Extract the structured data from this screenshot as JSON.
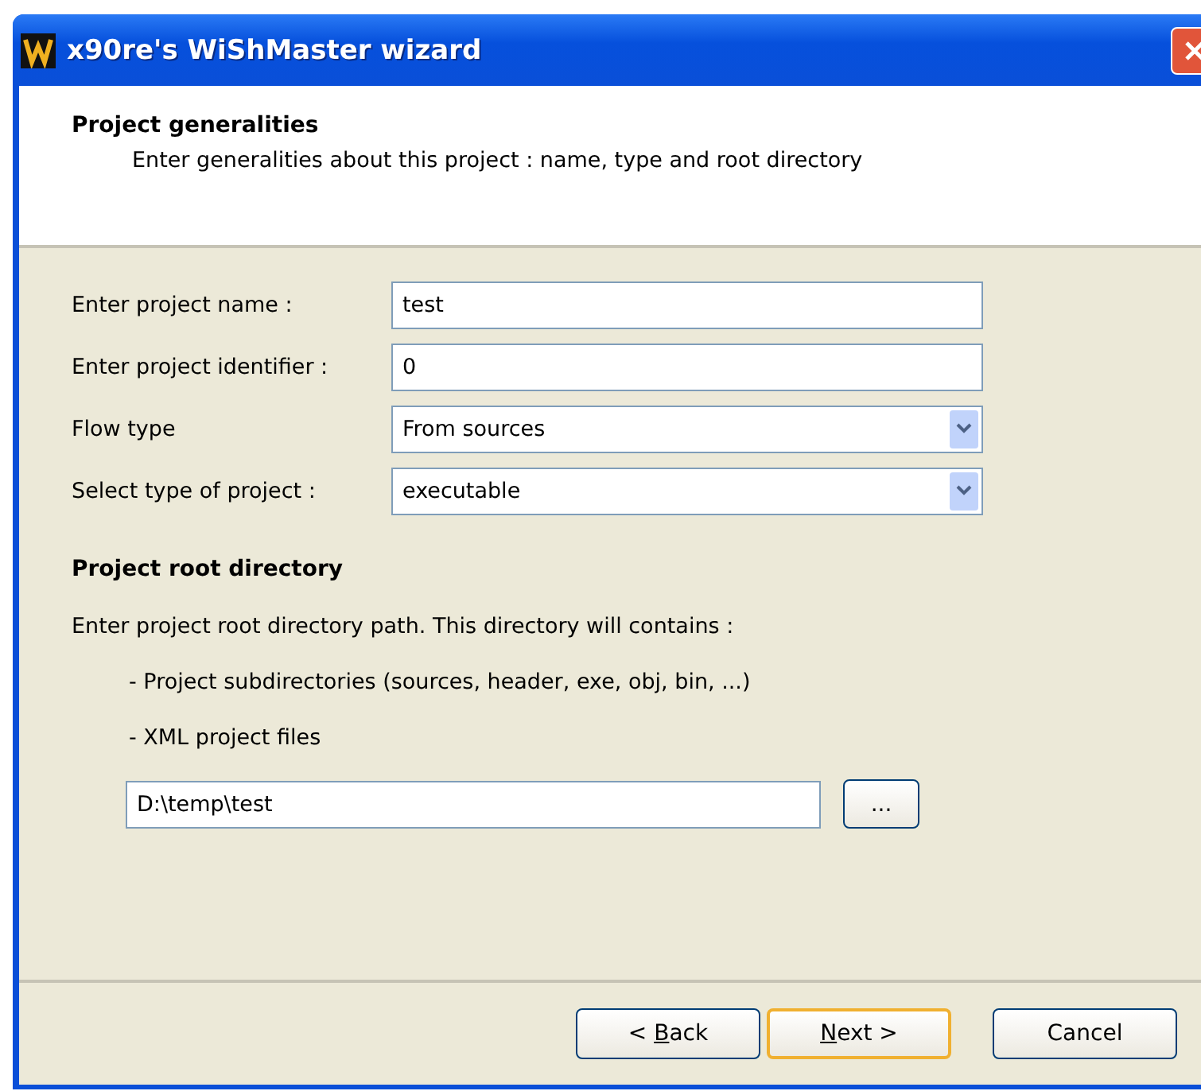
{
  "window": {
    "title": "x90re's WiShMaster wizard"
  },
  "header": {
    "title": "Project generalities",
    "subtitle": "Enter generalities about this project : name, type and root directory"
  },
  "fields": [
    {
      "kind": "text",
      "label": "Enter project name :",
      "value": "test"
    },
    {
      "kind": "text",
      "label": "Enter project identifier :",
      "value": "0"
    },
    {
      "kind": "select",
      "label": "Flow type",
      "value": "From sources"
    },
    {
      "kind": "select",
      "label": "Select type of project :",
      "value": "executable"
    }
  ],
  "root": {
    "title": "Project root directory",
    "intro": "Enter project root directory path. This directory will contains :",
    "bullets": [
      "- Project subdirectories (sources, header, exe, obj, bin, ...)",
      "- XML project files"
    ],
    "path": "D:\\temp\\test",
    "browse": "..."
  },
  "buttons": [
    {
      "pre": "< ",
      "key": "B",
      "post": "ack",
      "default": false
    },
    {
      "key": "N",
      "post": "ext >",
      "default": true
    },
    {
      "post": "Cancel",
      "default": false
    }
  ]
}
